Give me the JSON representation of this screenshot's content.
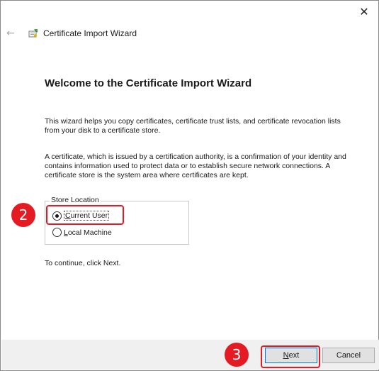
{
  "window": {
    "close_glyph": "✕"
  },
  "header": {
    "back_glyph": "←",
    "icon": "certificate-wizard-icon",
    "title": "Certificate Import Wizard"
  },
  "content": {
    "title": "Welcome to the Certificate Import Wizard",
    "paragraph1": "This wizard helps you copy certificates, certificate trust lists, and certificate revocation lists from your disk to a certificate store.",
    "paragraph2": "A certificate, which is issued by a certification authority, is a confirmation of your identity and contains information used to protect data or to establish secure network connections. A certificate store is the system area where certificates are kept.",
    "store_location": {
      "label": "Store Location",
      "options": [
        {
          "label_first": "C",
          "label_rest": "urrent User",
          "selected": true
        },
        {
          "label_first": "L",
          "label_rest": "ocal Machine",
          "selected": false
        }
      ]
    },
    "continue_text": "To continue, click Next."
  },
  "annotations": {
    "step2": "2",
    "step3": "3",
    "highlight_color": "#e41b23"
  },
  "footer": {
    "next_first": "N",
    "next_rest": "ext",
    "cancel_label": "Cancel"
  }
}
